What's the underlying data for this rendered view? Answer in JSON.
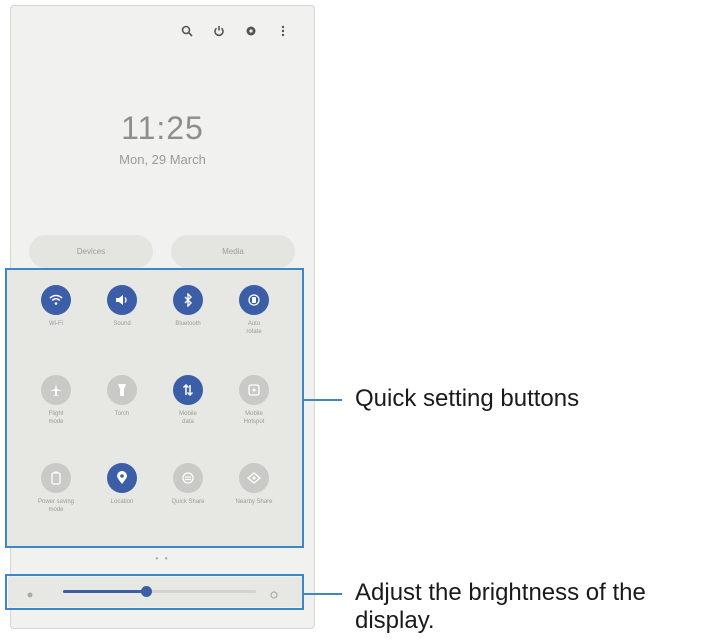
{
  "clock": {
    "time": "11:25",
    "date": "Mon, 29 March"
  },
  "top_icons": [
    "search-icon",
    "power-icon",
    "settings-icon",
    "more-options-icon"
  ],
  "panels": {
    "devices": "Devices",
    "media": "Media"
  },
  "quick_settings": [
    {
      "label": "Wi-Fi",
      "icon": "wifi-icon",
      "state": "on"
    },
    {
      "label": "Sound",
      "icon": "sound-icon",
      "state": "on"
    },
    {
      "label": "Bluetooth",
      "icon": "bluetooth-icon",
      "state": "on"
    },
    {
      "label": "Auto\nrotate",
      "icon": "auto-rotate-icon",
      "state": "on"
    },
    {
      "label": "Flight\nmode",
      "icon": "flight-mode-icon",
      "state": "off"
    },
    {
      "label": "Torch",
      "icon": "torch-icon",
      "state": "off"
    },
    {
      "label": "Mobile\ndata",
      "icon": "mobile-data-icon",
      "state": "on"
    },
    {
      "label": "Mobile\nHotspot",
      "icon": "mobile-hotspot-icon",
      "state": "off"
    },
    {
      "label": "Power saving\nmode",
      "icon": "power-saving-icon",
      "state": "off"
    },
    {
      "label": "Location",
      "icon": "location-icon",
      "state": "on"
    },
    {
      "label": "Quick Share",
      "icon": "quick-share-icon",
      "state": "off"
    },
    {
      "label": "Nearby Share",
      "icon": "nearby-share-icon",
      "state": "off"
    }
  ],
  "brightness": {
    "level": 0.43
  },
  "callouts": {
    "quick_settings": "Quick setting buttons",
    "brightness_line1": "Adjust the brightness of the",
    "brightness_line2": "display."
  },
  "colors": {
    "accent": "#3e86c6",
    "tile_on": "#3b5ea6",
    "tile_off": "#c9c9c6",
    "panel": "#e7e7e4"
  }
}
